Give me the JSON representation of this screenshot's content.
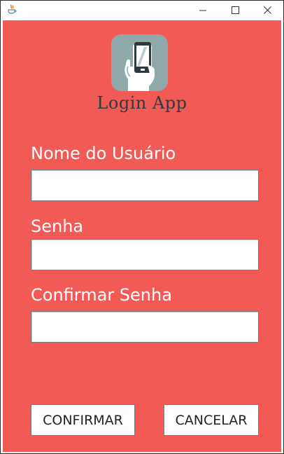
{
  "window": {
    "app_icon": "java-icon",
    "controls": {
      "minimize": "minimize-icon",
      "maximize": "maximize-icon",
      "close": "close-icon"
    }
  },
  "header": {
    "logo_icon": "phone-in-hand-icon",
    "title": "Login App"
  },
  "form": {
    "username_label": "Nome do Usuário",
    "username_value": "",
    "password_label": "Senha",
    "password_value": "",
    "confirm_label": "Confirmar Senha",
    "confirm_value": ""
  },
  "buttons": {
    "confirm": "CONFIRMAR",
    "cancel": "CANCELAR"
  },
  "colors": {
    "background": "#f25a55",
    "logo_tile": "#8fa8aa",
    "title_text": "#2e3b3e",
    "label_text": "#ffffff"
  }
}
